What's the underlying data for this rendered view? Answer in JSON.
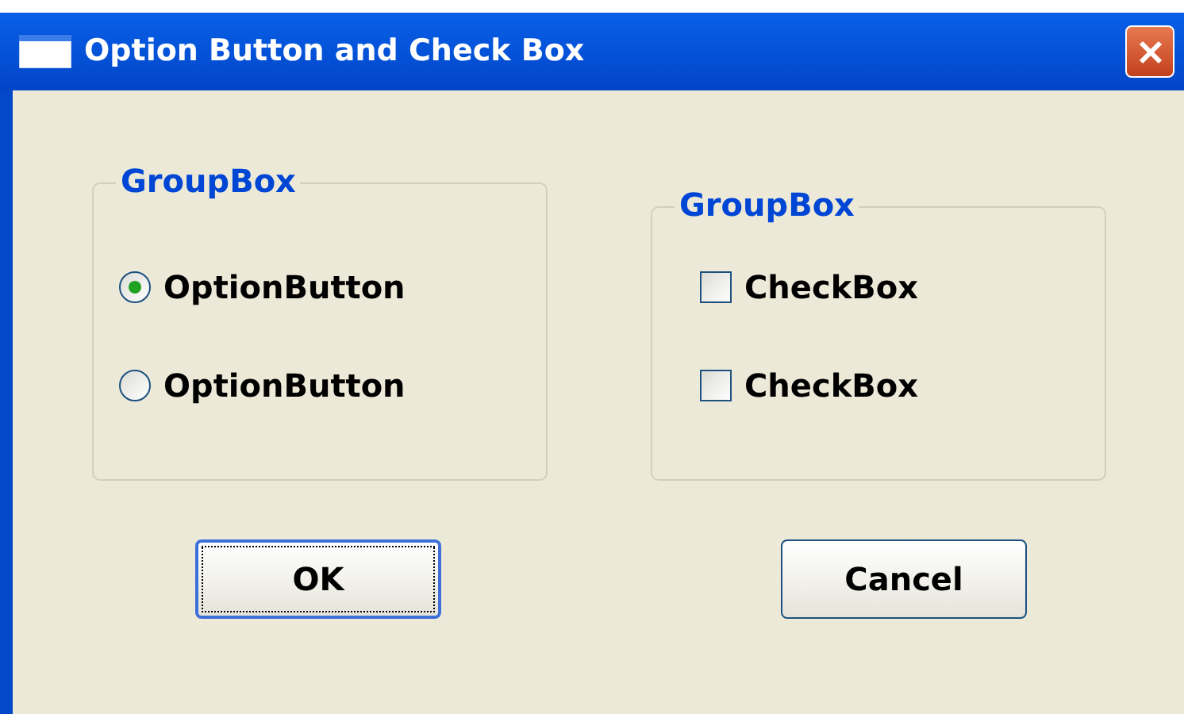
{
  "window": {
    "title": "Option Button and Check Box"
  },
  "groups": [
    {
      "label": "GroupBox",
      "items": [
        {
          "kind": "radio",
          "label": "OptionButton",
          "selected": true
        },
        {
          "kind": "radio",
          "label": "OptionButton",
          "selected": false
        }
      ]
    },
    {
      "label": "GroupBox",
      "items": [
        {
          "kind": "checkbox",
          "label": "CheckBox",
          "checked": false
        },
        {
          "kind": "checkbox",
          "label": "CheckBox",
          "checked": false
        }
      ]
    }
  ],
  "buttons": [
    {
      "label": "OK",
      "focused": true
    },
    {
      "label": "Cancel",
      "focused": false
    }
  ]
}
